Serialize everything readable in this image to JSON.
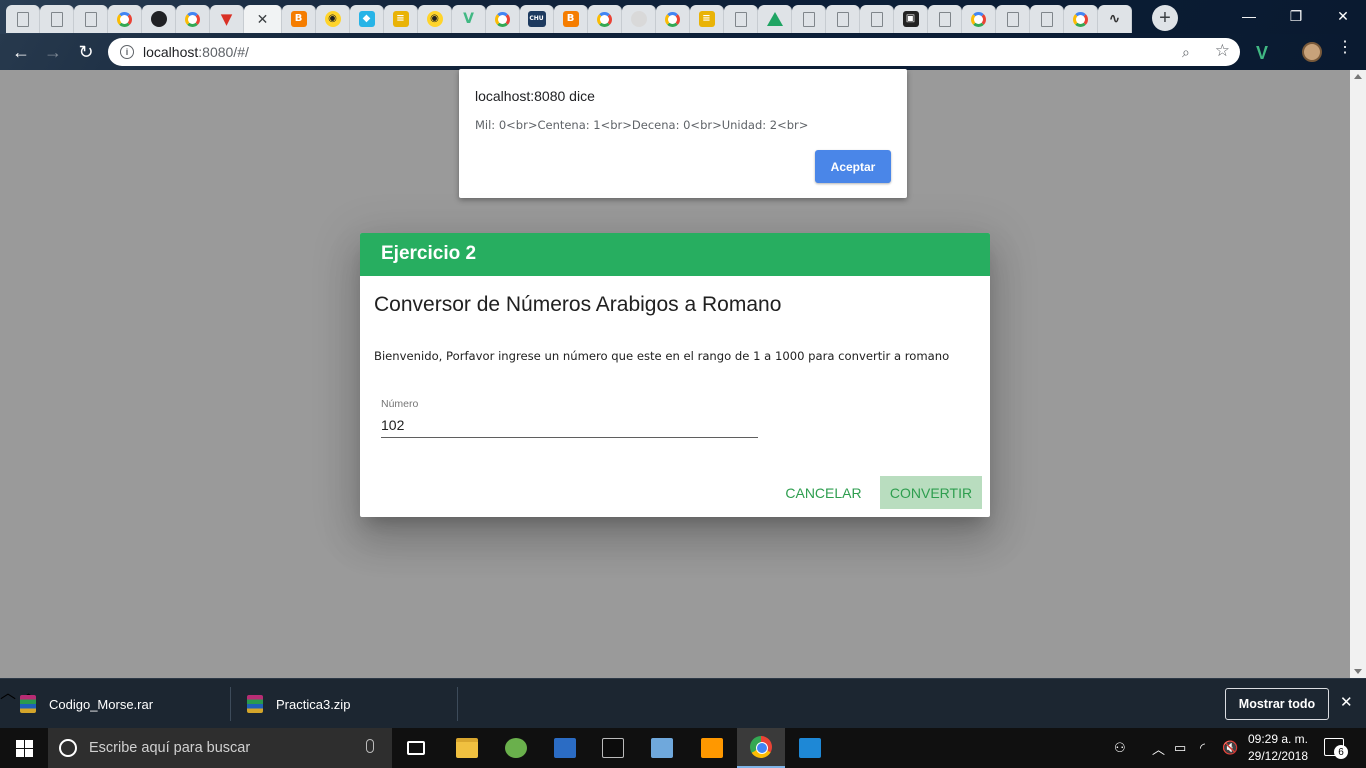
{
  "browser": {
    "address": {
      "host": "localhost",
      "rest": ":8080/#/"
    },
    "tab_icons": [
      "doc-icon",
      "doc-icon",
      "doc-icon",
      "google-icon",
      "github-icon",
      "google-icon",
      "vivaldi-icon",
      "close-icon",
      "blogger-icon",
      "yellow-circle-icon",
      "cyan-bird-icon",
      "stackoverflow-icon",
      "yellow-circle-icon",
      "vue-icon",
      "google-icon",
      "chu-icon",
      "blogger-icon",
      "google-icon",
      "ball-icon",
      "google-icon",
      "stackoverflow-icon",
      "doc-icon",
      "drive-icon",
      "doc-icon",
      "doc-icon",
      "doc-icon",
      "cow-icon",
      "doc-icon",
      "google-icon",
      "doc-icon",
      "doc-icon",
      "google-icon",
      "wave-icon"
    ]
  },
  "alert": {
    "title": "localhost:8080 dice",
    "message": "Mil: 0<br>Centena: 1<br>Decena: 0<br>Unidad: 2<br>",
    "ok_label": "Aceptar"
  },
  "dialog": {
    "header": "Ejercicio 2",
    "title": "Conversor de Números Arabigos a Romano",
    "welcome": "Bienvenido, Porfavor ingrese un número que este en el rango de 1 a 1000 para convertir a romano",
    "field_label": "Número",
    "field_value": "102",
    "cancel_label": "CANCELAR",
    "convert_label": "CONVERTIR"
  },
  "downloads": {
    "items": [
      {
        "name": "Codigo_Morse.rar"
      },
      {
        "name": "Practica3.zip"
      }
    ],
    "show_all_label": "Mostrar todo"
  },
  "taskbar": {
    "search_placeholder": "Escribe aquí para buscar",
    "time": "09:29 a. m.",
    "date": "29/12/2018",
    "notification_count": "6"
  },
  "colors": {
    "dialog_header": "#27ae60",
    "alert_button": "#4a86e8",
    "overlay": "#9a9a9a"
  }
}
